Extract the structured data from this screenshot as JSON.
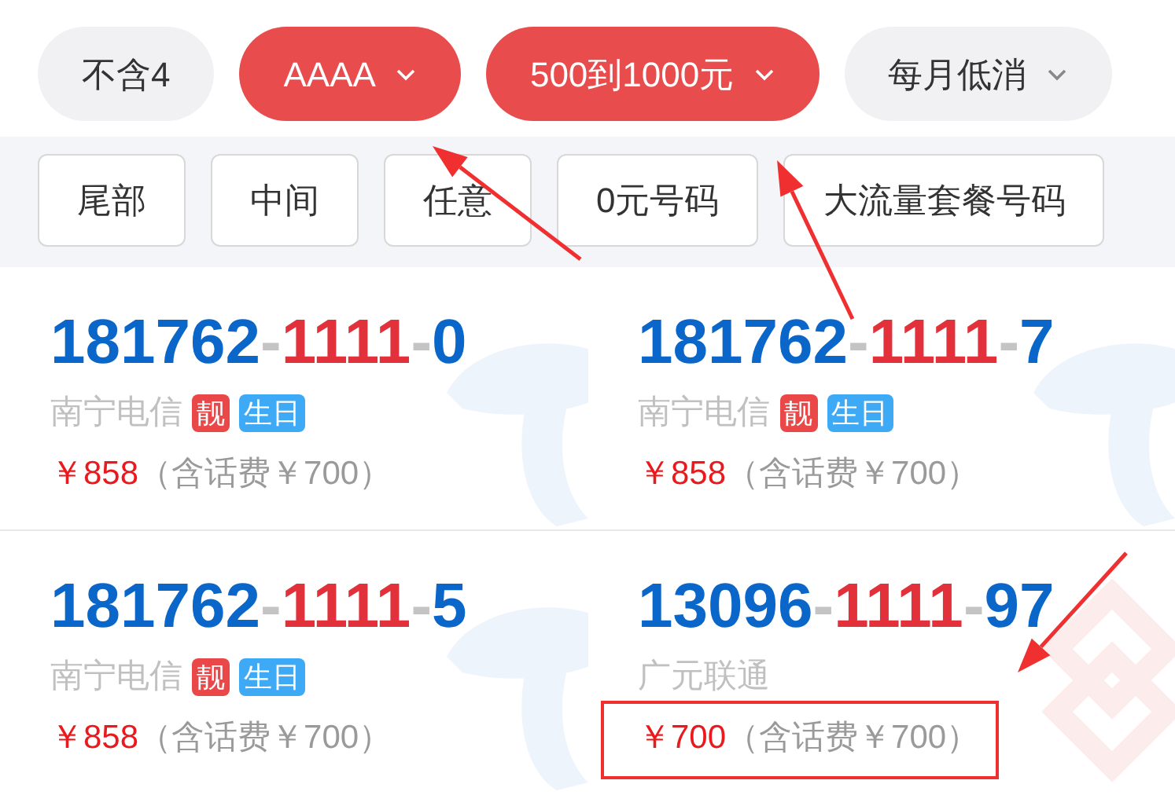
{
  "filters": [
    {
      "label": "不含4",
      "kind": "toggle",
      "selected": false,
      "annotated": false
    },
    {
      "label": "AAAA",
      "kind": "dropdown",
      "selected": true,
      "annotated": true
    },
    {
      "label": "500到1000元",
      "kind": "dropdown",
      "selected": true,
      "annotated": true
    },
    {
      "label": "每月低消",
      "kind": "dropdown",
      "selected": false,
      "annotated": false
    }
  ],
  "positions": [
    {
      "label": "尾部"
    },
    {
      "label": "中间"
    },
    {
      "label": "任意"
    },
    {
      "label": "0元号码"
    },
    {
      "label": "大流量套餐号码"
    }
  ],
  "numbers": [
    {
      "segments": [
        {
          "text": "181762",
          "kind": "head"
        },
        {
          "text": "-",
          "kind": "sep"
        },
        {
          "text": "1111",
          "kind": "core"
        },
        {
          "text": "-",
          "kind": "sep"
        },
        {
          "text": "0",
          "kind": "head"
        }
      ],
      "carrier": "南宁电信",
      "tags": [
        {
          "text": "靓",
          "color": "#ea4848"
        },
        {
          "text": "生日",
          "color": "#3eaaf5"
        }
      ],
      "price": "￥858",
      "note": "（含话费￥700）",
      "kind": "swirl",
      "annotated": false
    },
    {
      "segments": [
        {
          "text": "181762",
          "kind": "head"
        },
        {
          "text": "-",
          "kind": "sep"
        },
        {
          "text": "1111",
          "kind": "core"
        },
        {
          "text": "-",
          "kind": "sep"
        },
        {
          "text": "7",
          "kind": "head"
        }
      ],
      "carrier": "南宁电信",
      "tags": [
        {
          "text": "靓",
          "color": "#ea4848"
        },
        {
          "text": "生日",
          "color": "#3eaaf5"
        }
      ],
      "price": "￥858",
      "note": "（含话费￥700）",
      "kind": "swirl",
      "annotated": false
    },
    {
      "segments": [
        {
          "text": "181762",
          "kind": "head"
        },
        {
          "text": "-",
          "kind": "sep"
        },
        {
          "text": "1111",
          "kind": "core"
        },
        {
          "text": "-",
          "kind": "sep"
        },
        {
          "text": "5",
          "kind": "head"
        }
      ],
      "carrier": "南宁电信",
      "tags": [
        {
          "text": "靓",
          "color": "#ea4848"
        },
        {
          "text": "生日",
          "color": "#3eaaf5"
        }
      ],
      "price": "￥858",
      "note": "（含话费￥700）",
      "kind": "swirl",
      "annotated": false
    },
    {
      "segments": [
        {
          "text": "13096",
          "kind": "head"
        },
        {
          "text": "-",
          "kind": "sep"
        },
        {
          "text": "1111",
          "kind": "core"
        },
        {
          "text": "-",
          "kind": "sep"
        },
        {
          "text": "97",
          "kind": "head"
        }
      ],
      "carrier": "广元联通",
      "price": "￥700",
      "note": "（含话费￥700）",
      "kind": "knot",
      "annotated": true
    }
  ]
}
